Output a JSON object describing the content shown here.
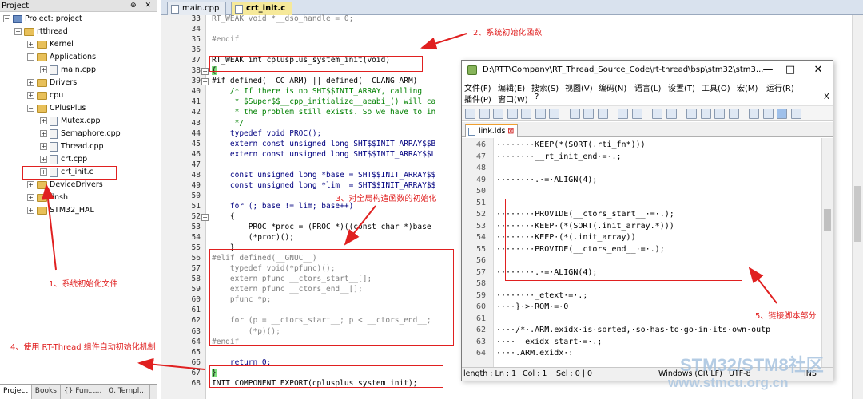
{
  "project_panel": {
    "title": "Project",
    "pin_label": "⊕ ✕",
    "items": [
      {
        "label": "Project: project",
        "level": 0,
        "kind": "project",
        "expander": "−"
      },
      {
        "label": "rtthread",
        "level": 1,
        "kind": "folder",
        "expander": "−"
      },
      {
        "label": "Kernel",
        "level": 2,
        "kind": "folder",
        "expander": "+"
      },
      {
        "label": "Applications",
        "level": 2,
        "kind": "folder",
        "expander": "−"
      },
      {
        "label": "main.cpp",
        "level": 3,
        "kind": "file",
        "expander": "+"
      },
      {
        "label": "Drivers",
        "level": 2,
        "kind": "folder",
        "expander": "+"
      },
      {
        "label": "cpu",
        "level": 2,
        "kind": "folder",
        "expander": "+"
      },
      {
        "label": "CPlusPlus",
        "level": 2,
        "kind": "folder",
        "expander": "−"
      },
      {
        "label": "Mutex.cpp",
        "level": 3,
        "kind": "file",
        "expander": "+"
      },
      {
        "label": "Semaphore.cpp",
        "level": 3,
        "kind": "file",
        "expander": "+"
      },
      {
        "label": "Thread.cpp",
        "level": 3,
        "kind": "file",
        "expander": "+"
      },
      {
        "label": "crt.cpp",
        "level": 3,
        "kind": "file",
        "expander": "+"
      },
      {
        "label": "crt_init.c",
        "level": 3,
        "kind": "file",
        "expander": "+"
      },
      {
        "label": "DeviceDrivers",
        "level": 2,
        "kind": "folder",
        "expander": "+"
      },
      {
        "label": "finsh",
        "level": 2,
        "kind": "folder",
        "expander": "+"
      },
      {
        "label": "STM32_HAL",
        "level": 2,
        "kind": "folder",
        "expander": "+"
      }
    ],
    "bottom_tabs": [
      "Project",
      "Books",
      "{} Funct...",
      "0, Templ..."
    ]
  },
  "editor": {
    "tabs": [
      {
        "label": "main.cpp",
        "active": false
      },
      {
        "label": "crt_init.c",
        "active": true
      }
    ],
    "lines": [
      {
        "n": "33",
        "code": "RT_WEAK void *__dso_handle = 0;",
        "color": "#808080",
        "fold": ""
      },
      {
        "n": "34",
        "code": "",
        "color": "#000",
        "fold": ""
      },
      {
        "n": "35",
        "code": "#endif",
        "color": "#808080",
        "fold": ""
      },
      {
        "n": "36",
        "code": "",
        "color": "#000",
        "fold": ""
      },
      {
        "n": "37",
        "code": "RT_WEAK int cplusplus_system_init(void)",
        "color": "#000",
        "fold": ""
      },
      {
        "n": "38",
        "code": "{",
        "color": "#000",
        "fold": "−"
      },
      {
        "n": "39",
        "code": "#if defined(__CC_ARM) || defined(__CLANG_ARM)",
        "color": "#000",
        "fold": "−"
      },
      {
        "n": "40",
        "code": "    /* If there is no SHT$$INIT_ARRAY, calling",
        "color": "#008000",
        "fold": ""
      },
      {
        "n": "41",
        "code": "     * $Super$$__cpp_initialize__aeabi_() will ca",
        "color": "#008000",
        "fold": ""
      },
      {
        "n": "42",
        "code": "     * the problem still exists. So we have to in",
        "color": "#008000",
        "fold": ""
      },
      {
        "n": "43",
        "code": "     */",
        "color": "#008000",
        "fold": ""
      },
      {
        "n": "44",
        "code": "    typedef void PROC();",
        "color": "#000080",
        "fold": ""
      },
      {
        "n": "45",
        "code": "    extern const unsigned long SHT$$INIT_ARRAY$$B",
        "color": "#000080",
        "fold": ""
      },
      {
        "n": "46",
        "code": "    extern const unsigned long SHT$$INIT_ARRAY$$L",
        "color": "#000080",
        "fold": ""
      },
      {
        "n": "47",
        "code": "",
        "color": "#000",
        "fold": ""
      },
      {
        "n": "48",
        "code": "    const unsigned long *base = SHT$$INIT_ARRAY$$",
        "color": "#000080",
        "fold": ""
      },
      {
        "n": "49",
        "code": "    const unsigned long *lim  = SHT$$INIT_ARRAY$$",
        "color": "#000080",
        "fold": ""
      },
      {
        "n": "50",
        "code": "",
        "color": "#000",
        "fold": ""
      },
      {
        "n": "51",
        "code": "    for (; base != lim; base++)",
        "color": "#000080",
        "fold": ""
      },
      {
        "n": "52",
        "code": "    {",
        "color": "#000",
        "fold": "−"
      },
      {
        "n": "53",
        "code": "        PROC *proc = (PROC *)((const char *)base",
        "color": "#000",
        "fold": ""
      },
      {
        "n": "54",
        "code": "        (*proc)();",
        "color": "#000",
        "fold": ""
      },
      {
        "n": "55",
        "code": "    }",
        "color": "#000",
        "fold": ""
      },
      {
        "n": "56",
        "code": "#elif defined(__GNUC__)",
        "color": "#808080",
        "fold": ""
      },
      {
        "n": "57",
        "code": "    typedef void(*pfunc)();",
        "color": "#808080",
        "fold": ""
      },
      {
        "n": "58",
        "code": "    extern pfunc __ctors_start__[];",
        "color": "#808080",
        "fold": ""
      },
      {
        "n": "59",
        "code": "    extern pfunc __ctors_end__[];",
        "color": "#808080",
        "fold": ""
      },
      {
        "n": "60",
        "code": "    pfunc *p;",
        "color": "#808080",
        "fold": ""
      },
      {
        "n": "61",
        "code": "",
        "color": "#000",
        "fold": ""
      },
      {
        "n": "62",
        "code": "    for (p = __ctors_start__; p < __ctors_end__;",
        "color": "#808080",
        "fold": ""
      },
      {
        "n": "63",
        "code": "        (*p)();",
        "color": "#808080",
        "fold": ""
      },
      {
        "n": "64",
        "code": "#endif",
        "color": "#808080",
        "fold": ""
      },
      {
        "n": "65",
        "code": "",
        "color": "#000",
        "fold": ""
      },
      {
        "n": "66",
        "code": "    return 0;",
        "color": "#000080",
        "fold": ""
      },
      {
        "n": "67",
        "code": "}",
        "color": "#000",
        "fold": ""
      },
      {
        "n": "68",
        "code": "INIT_COMPONENT_EXPORT(cplusplus_system_init);",
        "color": "#000",
        "fold": ""
      }
    ]
  },
  "notepad": {
    "title": "D:\\RTT\\Company\\RT_Thread_Source_Code\\rt-thread\\bsp\\stm32\\stm3...",
    "window_buttons": [
      "—",
      "□",
      "✕"
    ],
    "menu_row1": [
      "文件(F)",
      "编辑(E)",
      "搜索(S)",
      "视图(V)",
      "编码(N)",
      "语言(L)",
      "设置(T)",
      "工具(O)",
      "宏(M)",
      "运行(R)"
    ],
    "menu_row2": [
      "插件(P)",
      "窗口(W)",
      "?"
    ],
    "menu_close": "X",
    "tab_label": "link.lds",
    "lines": [
      {
        "n": "46",
        "code": "········KEEP(*(SORT(.rti_fn*)))"
      },
      {
        "n": "47",
        "code": "········__rt_init_end·=·.;"
      },
      {
        "n": "48",
        "code": ""
      },
      {
        "n": "49",
        "code": "········.·=·ALIGN(4);"
      },
      {
        "n": "50",
        "code": ""
      },
      {
        "n": "51",
        "code": ""
      },
      {
        "n": "52",
        "code": "········PROVIDE(__ctors_start__·=·.);"
      },
      {
        "n": "53",
        "code": "········KEEP·(*(SORT(.init_array.*)))"
      },
      {
        "n": "54",
        "code": "········KEEP·(*(.init_array))"
      },
      {
        "n": "55",
        "code": "········PROVIDE(__ctors_end__·=·.);"
      },
      {
        "n": "56",
        "code": ""
      },
      {
        "n": "57",
        "code": "········.·=·ALIGN(4);"
      },
      {
        "n": "58",
        "code": ""
      },
      {
        "n": "59",
        "code": "········_etext·=·.;"
      },
      {
        "n": "60",
        "code": "····}·>·ROM·=·0"
      },
      {
        "n": "61",
        "code": ""
      },
      {
        "n": "62",
        "code": "····/*·.ARM.exidx·is·sorted,·so·has·to·go·in·its·own·outp"
      },
      {
        "n": "63",
        "code": "····__exidx_start·=·.;"
      },
      {
        "n": "64",
        "code": "····.ARM.exidx·:"
      }
    ],
    "status": {
      "length": "length : Ln : 1",
      "col": "Col : 1",
      "sel": "Sel : 0 | 0",
      "eol": "Windows (CR LF)",
      "encoding": "UTF-8",
      "mode": "INS"
    }
  },
  "annotations": {
    "note1": "1、系统初始化文件",
    "note2": "2、系统初始化函数",
    "note3": "3、对全局构造函数的初始化",
    "note4": "4、使用 RT-Thread 组件自动初始化机制",
    "note5": "5、链接脚本部分",
    "color": "#e02020"
  },
  "watermark": {
    "line1": "STM32/STM8社区",
    "line2": "www.stmcu.org.cn"
  }
}
